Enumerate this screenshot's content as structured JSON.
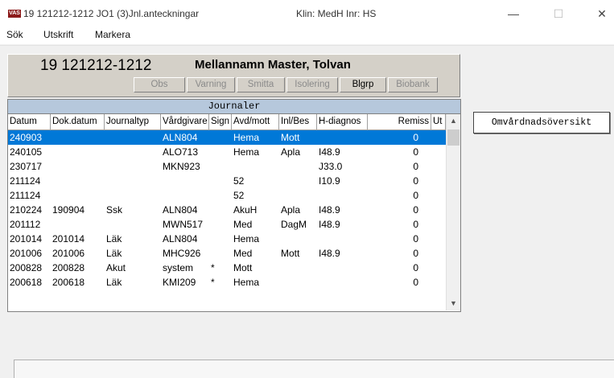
{
  "window": {
    "title": "19 121212-1212  JO1 (3)Jnl.anteckningar",
    "klin": "Klin: MedH  Inr: HS",
    "icon_text": "VAS",
    "minimize": "—",
    "maximize": "☐",
    "close": "✕"
  },
  "menu": [
    "Sök",
    "Utskrift",
    "Markera"
  ],
  "patient": {
    "id": "19 121212-1212",
    "name": "Mellannamn Master, Tolvan"
  },
  "patient_buttons": [
    {
      "label": "Obs",
      "enabled": false
    },
    {
      "label": "Varning",
      "enabled": false
    },
    {
      "label": "Smitta",
      "enabled": false
    },
    {
      "label": "Isolering",
      "enabled": false
    },
    {
      "label": "Blgrp",
      "enabled": true
    },
    {
      "label": "Biobank",
      "enabled": false
    }
  ],
  "journal": {
    "title": "Journaler",
    "columns": [
      "Datum",
      "Dok.datum",
      "Journaltyp",
      "Vårdgivare",
      "Sign",
      "Avd/mott",
      "Inl/Bes",
      "H-diagnos",
      "Remiss",
      "Ut"
    ],
    "rows": [
      [
        "240903",
        "",
        "",
        "ALN804",
        "",
        "Hema",
        "Mott",
        "",
        "0",
        ""
      ],
      [
        "240105",
        "",
        "",
        "ALO713",
        "",
        "Hema",
        "Apla",
        "I48.9",
        "0",
        ""
      ],
      [
        "230717",
        "",
        "",
        "MKN923",
        "",
        "",
        "",
        "J33.0",
        "0",
        ""
      ],
      [
        "211124",
        "",
        "",
        "",
        "",
        "52",
        "",
        "I10.9",
        "0",
        ""
      ],
      [
        "211124",
        "",
        "",
        "",
        "",
        "52",
        "",
        "",
        "0",
        ""
      ],
      [
        "210224",
        "190904",
        "Ssk",
        "ALN804",
        "",
        "AkuH",
        "Apla",
        "I48.9",
        "0",
        ""
      ],
      [
        "201112",
        "",
        "",
        "MWN517",
        "",
        "Med",
        "DagM",
        "I48.9",
        "0",
        ""
      ],
      [
        "201014",
        "201014",
        "Läk",
        "ALN804",
        "",
        "Hema",
        "",
        "",
        "0",
        ""
      ],
      [
        "201006",
        "201006",
        "Läk",
        "MHC926",
        "",
        "Med",
        "Mott",
        "I48.9",
        "0",
        ""
      ],
      [
        "200828",
        "200828",
        "Akut",
        "system",
        "*",
        "Mott",
        "",
        "",
        "0",
        ""
      ],
      [
        "200618",
        "200618",
        "Läk",
        "KMI209",
        "*",
        "Hema",
        "",
        "",
        "0",
        ""
      ]
    ],
    "selected_row": 0
  },
  "overview_button": "Omvårdnadsöversikt"
}
